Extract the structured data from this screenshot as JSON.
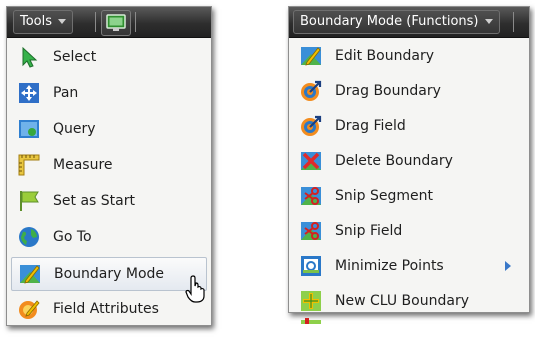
{
  "left_panel": {
    "tools_label": "Tools",
    "items": [
      {
        "label": "Select",
        "icon": "select-arrow-icon"
      },
      {
        "label": "Pan",
        "icon": "pan-icon"
      },
      {
        "label": "Query",
        "icon": "query-icon"
      },
      {
        "label": "Measure",
        "icon": "ruler-icon"
      },
      {
        "label": "Set as Start",
        "icon": "flag-icon"
      },
      {
        "label": "Go To",
        "icon": "globe-icon"
      },
      {
        "label": "Boundary Mode",
        "icon": "boundary-mode-icon",
        "highlighted": true
      },
      {
        "label": "Field Attributes",
        "icon": "field-attributes-icon"
      }
    ]
  },
  "right_panel": {
    "mode_label": "Boundary Mode (Functions)",
    "items": [
      {
        "label": "Edit Boundary",
        "icon": "edit-boundary-icon"
      },
      {
        "label": "Drag Boundary",
        "icon": "drag-boundary-icon"
      },
      {
        "label": "Drag Field",
        "icon": "drag-field-icon"
      },
      {
        "label": "Delete Boundary",
        "icon": "delete-boundary-icon"
      },
      {
        "label": "Snip Segment",
        "icon": "snip-segment-icon"
      },
      {
        "label": "Snip Field",
        "icon": "snip-field-icon"
      },
      {
        "label": "Minimize Points",
        "icon": "minimize-points-icon",
        "has_submenu": true
      },
      {
        "label": "New CLU Boundary",
        "icon": "new-clu-boundary-icon"
      }
    ]
  },
  "colors": {
    "toolbar_dark": "#2e2e2e",
    "menu_bg": "#f5f5f3",
    "highlight_border": "#b9c3cf",
    "submenu_arrow": "#3a78c8"
  }
}
